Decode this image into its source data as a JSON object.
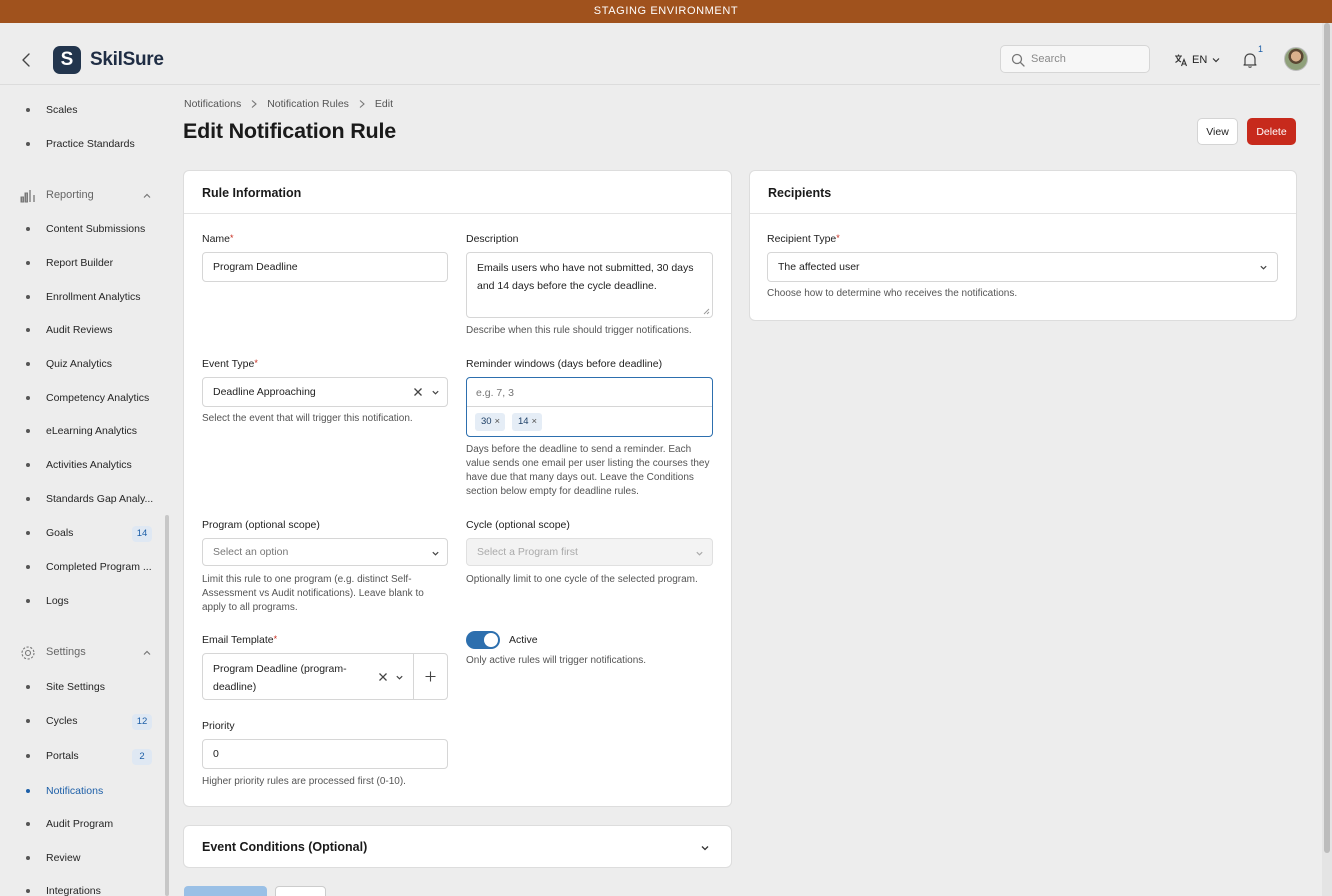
{
  "banner": {
    "text": "STAGING ENVIRONMENT"
  },
  "header": {
    "logo_text": "SkilSure",
    "logo_mark": "S",
    "search_placeholder": "Search",
    "language": "EN",
    "notification_count": "1"
  },
  "sidebar": {
    "items_top": [
      {
        "label": "Scales"
      },
      {
        "label": "Practice Standards"
      }
    ],
    "reporting": {
      "label": "Reporting",
      "items": [
        {
          "label": "Content Submissions"
        },
        {
          "label": "Report Builder"
        },
        {
          "label": "Enrollment Analytics"
        },
        {
          "label": "Audit Reviews"
        },
        {
          "label": "Quiz Analytics"
        },
        {
          "label": "Competency Analytics"
        },
        {
          "label": "eLearning Analytics"
        },
        {
          "label": "Activities Analytics"
        },
        {
          "label": "Standards Gap Analy..."
        },
        {
          "label": "Goals",
          "badge": "14"
        },
        {
          "label": "Completed Program ..."
        },
        {
          "label": "Logs"
        }
      ]
    },
    "settings": {
      "label": "Settings",
      "items": [
        {
          "label": "Site Settings"
        },
        {
          "label": "Cycles",
          "badge": "12"
        },
        {
          "label": "Portals",
          "badge": "2"
        },
        {
          "label": "Notifications",
          "active": true
        },
        {
          "label": "Audit Program"
        },
        {
          "label": "Review"
        },
        {
          "label": "Integrations"
        }
      ]
    }
  },
  "breadcrumb": [
    "Notifications",
    "Notification Rules",
    "Edit"
  ],
  "page_title": "Edit Notification Rule",
  "actions": {
    "view": "View",
    "delete": "Delete"
  },
  "rule_card": {
    "title": "Rule Information",
    "name": {
      "label": "Name",
      "value": "Program Deadline"
    },
    "description": {
      "label": "Description",
      "value": "Emails users who have not submitted, 30 days and 14 days before the cycle deadline.",
      "help": "Describe when this rule should trigger notifications."
    },
    "event_type": {
      "label": "Event Type",
      "value": "Deadline Approaching",
      "help": "Select the event that will trigger this notification."
    },
    "reminder": {
      "label": "Reminder windows (days before deadline)",
      "placeholder": "e.g. 7, 3",
      "tags": [
        "30",
        "14"
      ],
      "help": "Days before the deadline to send a reminder. Each value sends one email per user listing the courses they have due that many days out. Leave the Conditions section below empty for deadline rules."
    },
    "program": {
      "label": "Program (optional scope)",
      "placeholder": "Select an option",
      "help": "Limit this rule to one program (e.g. distinct Self-Assessment vs Audit notifications). Leave blank to apply to all programs."
    },
    "cycle": {
      "label": "Cycle (optional scope)",
      "placeholder": "Select a Program first",
      "help": "Optionally limit to one cycle of the selected program."
    },
    "email_template": {
      "label": "Email Template",
      "value_line1": "Program Deadline (program-",
      "value_line2": "deadline)"
    },
    "active": {
      "label": "Active",
      "on": true,
      "help": "Only active rules will trigger notifications."
    },
    "priority": {
      "label": "Priority",
      "value": "0",
      "help": "Higher priority rules are processed first (0-10)."
    }
  },
  "recipients_card": {
    "title": "Recipients",
    "label": "Recipient Type",
    "value": "The affected user",
    "help": "Choose how to determine who receives the notifications."
  },
  "conditions_card": {
    "title": "Event Conditions (Optional)"
  },
  "colors": {
    "accent": "#2d6fae",
    "danger": "#c72a1c",
    "banner": "#a0521d"
  }
}
